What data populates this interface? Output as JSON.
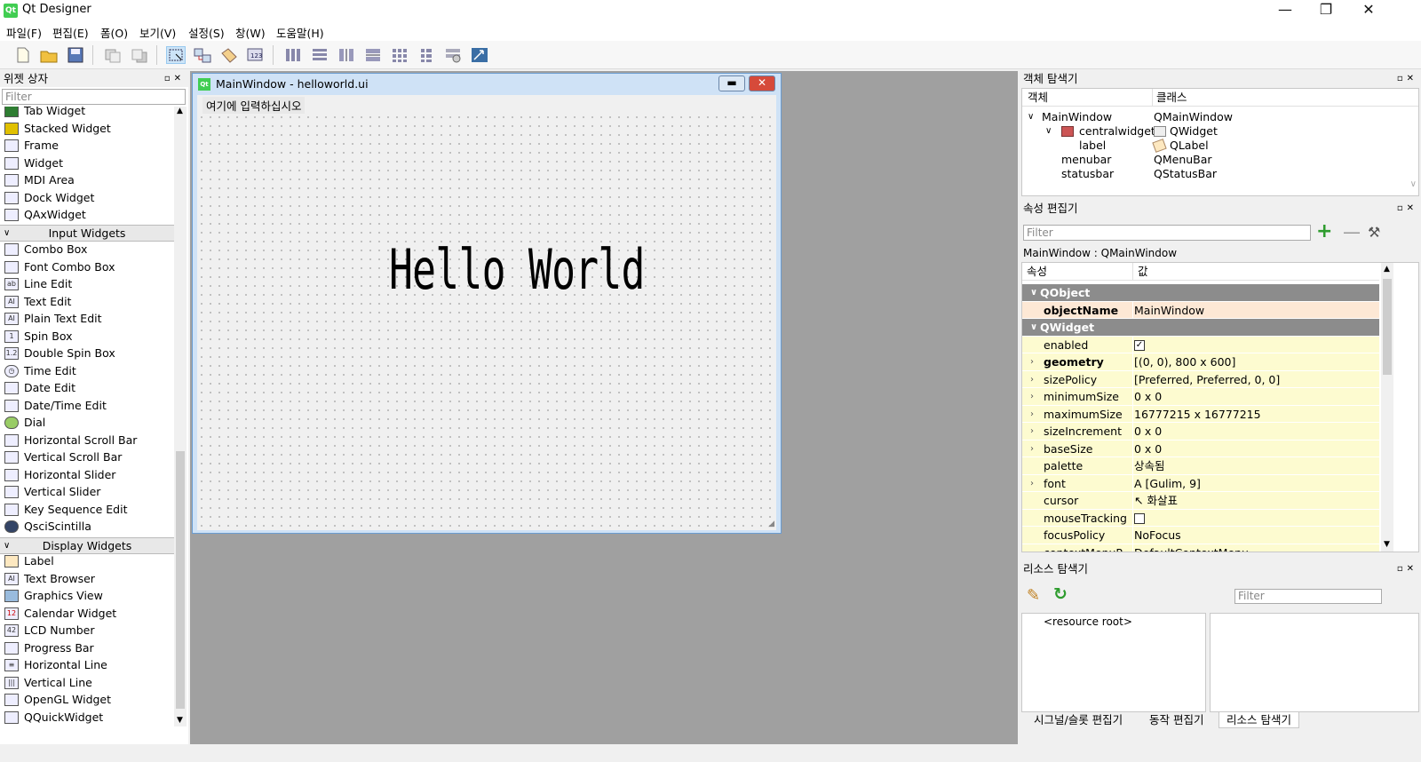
{
  "window": {
    "title": "Qt Designer",
    "app_icon_text": "Qt",
    "controls": {
      "minimize": "—",
      "restore": "❐",
      "close": "✕"
    }
  },
  "menubar": [
    "파일(F)",
    "편집(E)",
    "폼(O)",
    "보기(V)",
    "설정(S)",
    "창(W)",
    "도움말(H)"
  ],
  "widget_box": {
    "title": "위젯 상자",
    "filter_placeholder": "Filter",
    "items_top": [
      "Tab Widget",
      "Stacked Widget",
      "Frame",
      "Widget",
      "MDI Area",
      "Dock Widget",
      "QAxWidget"
    ],
    "category_input": "Input Widgets",
    "items_input": [
      "Combo Box",
      "Font Combo Box",
      "Line Edit",
      "Text Edit",
      "Plain Text Edit",
      "Spin Box",
      "Double Spin Box",
      "Time Edit",
      "Date Edit",
      "Date/Time Edit",
      "Dial",
      "Horizontal Scroll Bar",
      "Vertical Scroll Bar",
      "Horizontal Slider",
      "Vertical Slider",
      "Key Sequence Edit",
      "QsciScintilla"
    ],
    "category_display": "Display Widgets",
    "items_display": [
      "Label",
      "Text Browser",
      "Graphics View",
      "Calendar Widget",
      "LCD Number",
      "Progress Bar",
      "Horizontal Line",
      "Vertical Line",
      "OpenGL Widget",
      "QQuickWidget"
    ]
  },
  "form": {
    "title": "MainWindow - helloworld.ui",
    "menu_hint": "여기에 입력하십시오",
    "label_text": "Hello World"
  },
  "object_inspector": {
    "title": "객체 탐색기",
    "col_object": "객체",
    "col_class": "클래스",
    "rows": [
      {
        "object": "MainWindow",
        "class": "QMainWindow"
      },
      {
        "object": "centralwidget",
        "class": "QWidget"
      },
      {
        "object": "label",
        "class": "QLabel"
      },
      {
        "object": "menubar",
        "class": "QMenuBar"
      },
      {
        "object": "statusbar",
        "class": "QStatusBar"
      }
    ]
  },
  "property_editor": {
    "title": "속성 편집기",
    "filter_placeholder": "Filter",
    "context": "MainWindow : QMainWindow",
    "col_property": "속성",
    "col_value": "값",
    "rows": [
      {
        "name": "QObject",
        "value": ""
      },
      {
        "name": "objectName",
        "value": "MainWindow"
      },
      {
        "name": "QWidget",
        "value": ""
      },
      {
        "name": "enabled",
        "value": "✓"
      },
      {
        "name": "geometry",
        "value": "[(0, 0), 800 x 600]"
      },
      {
        "name": "sizePolicy",
        "value": "[Preferred, Preferred, 0, 0]"
      },
      {
        "name": "minimumSize",
        "value": "0 x 0"
      },
      {
        "name": "maximumSize",
        "value": "16777215 x 16777215"
      },
      {
        "name": "sizeIncrement",
        "value": "0 x 0"
      },
      {
        "name": "baseSize",
        "value": "0 x 0"
      },
      {
        "name": "palette",
        "value": "상속됨"
      },
      {
        "name": "font",
        "value": "A  [Gulim, 9]"
      },
      {
        "name": "cursor",
        "value": "화살표"
      },
      {
        "name": "mouseTracking",
        "value": ""
      },
      {
        "name": "focusPolicy",
        "value": "NoFocus"
      },
      {
        "name": "contextMenuP",
        "value": "DefaultContextMenu"
      }
    ]
  },
  "resource_browser": {
    "title": "리소스 탐색기",
    "filter_placeholder": "Filter",
    "root": "<resource root>"
  },
  "bottom_tabs": [
    "시그널/슬롯 편집기",
    "동작 편집기",
    "리소스 탐색기"
  ],
  "colors": {
    "accent_green": "#41cd52",
    "group_header": "#8c8c8c",
    "property_yellow": "#fdfbd0",
    "property_peach": "#fde8d5",
    "mdi_background": "#a0a0a0"
  }
}
